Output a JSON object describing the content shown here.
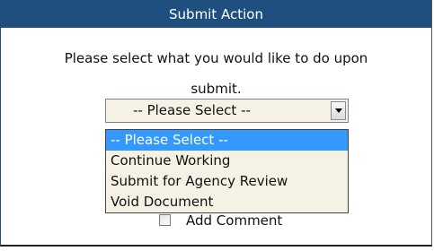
{
  "dialog": {
    "title": "Submit Action",
    "prompt_line1": "Please select what you would like to do upon",
    "prompt_line2": "submit."
  },
  "action_select": {
    "selected": "-- Please Select --",
    "options": [
      "-- Please Select --",
      "Continue Working",
      "Submit for Agency Review",
      "Void Document"
    ],
    "highlighted_index": 0
  },
  "comment": {
    "label": "Add Comment",
    "checked": false
  },
  "colors": {
    "titlebar": "#1f4f7e",
    "select_background": "#f5f1e4",
    "highlight": "#3399ff"
  },
  "icons": {
    "select_arrow": "chevron-down-icon"
  }
}
